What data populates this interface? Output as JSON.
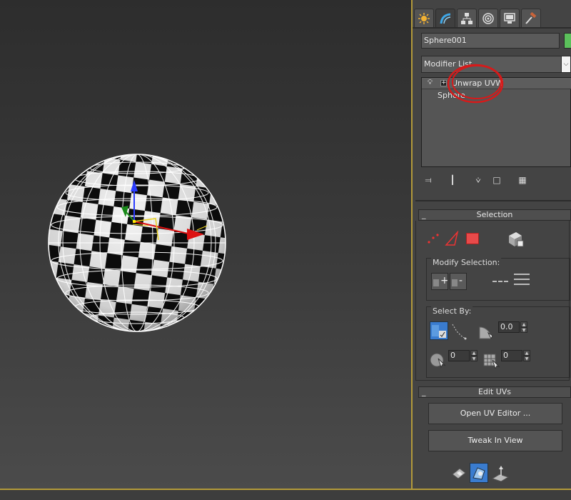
{
  "viewport": {
    "label": "Perspective viewport"
  },
  "command_panel": {
    "tabs": [
      {
        "name": "create-tab",
        "icon": "sun-star-icon"
      },
      {
        "name": "modify-tab",
        "icon": "modify-bend-icon"
      },
      {
        "name": "hierarchy-tab",
        "icon": "hierarchy-icon"
      },
      {
        "name": "motion-tab",
        "icon": "motion-circle-icon"
      },
      {
        "name": "display-tab",
        "icon": "monitor-icon"
      },
      {
        "name": "utilities-tab",
        "icon": "hammer-icon"
      }
    ],
    "active_tab": "modify-tab",
    "object_name": "Sphere001",
    "object_color": "#5bc15b",
    "modifier_list_label": "Modifier List",
    "stack": [
      {
        "label": "Unwrap UVW",
        "selected": true
      },
      {
        "label": "Sphere",
        "selected": false
      }
    ],
    "annotation_color": "#d61a1a"
  },
  "selection_rollout": {
    "title": "Selection",
    "collapse_symbol": "_",
    "modify_selection_label": "Modify Selection:",
    "select_by_label": "Select By:",
    "angle_value": "0.0",
    "spinner_a_value": "0",
    "spinner_b_value": "0"
  },
  "edit_uvs_rollout": {
    "title": "Edit UVs",
    "collapse_symbol": "_",
    "open_uv_editor_label": "Open UV Editor ...",
    "tweak_in_view_label": "Tweak In View"
  }
}
